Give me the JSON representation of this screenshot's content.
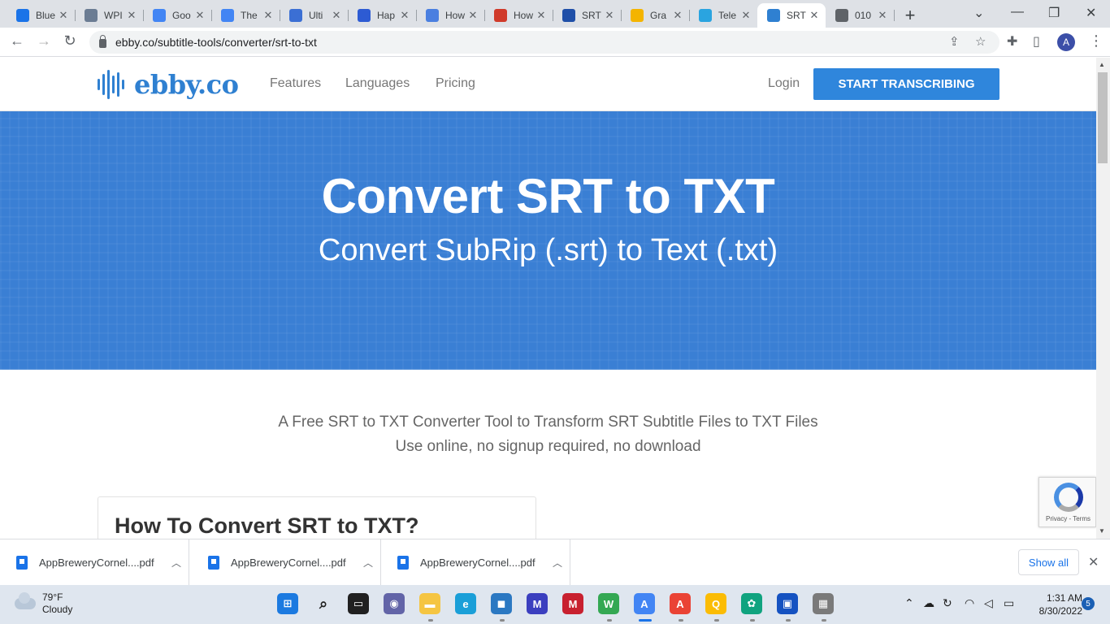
{
  "browser": {
    "tabs": [
      {
        "title": "Blue",
        "fav_color": "#1a73e8",
        "active": false
      },
      {
        "title": "WPI",
        "fav_color": "#6b7c93",
        "active": false
      },
      {
        "title": "Goo",
        "fav_color": "#4285f4",
        "active": false
      },
      {
        "title": "The",
        "fav_color": "#4285f4",
        "active": false
      },
      {
        "title": "Ulti",
        "fav_color": "#3b6fd4",
        "active": false
      },
      {
        "title": "Hap",
        "fav_color": "#2d5bd3",
        "active": false
      },
      {
        "title": "How",
        "fav_color": "#4a7fe0",
        "active": false
      },
      {
        "title": "How",
        "fav_color": "#d03a2a",
        "active": false
      },
      {
        "title": "SRT",
        "fav_color": "#1f4fa8",
        "active": false
      },
      {
        "title": "Gra",
        "fav_color": "#f4b400",
        "active": false
      },
      {
        "title": "Tele",
        "fav_color": "#2aa4e0",
        "active": false
      },
      {
        "title": "SRT",
        "fav_color": "#2f80d1",
        "active": true
      },
      {
        "title": "010",
        "fav_color": "#5f6368",
        "active": false
      }
    ],
    "url": "ebby.co/subtitle-tools/converter/srt-to-txt",
    "avatar_letter": "A"
  },
  "site": {
    "logo_text": "ebby.co",
    "nav": [
      "Features",
      "Languages",
      "Pricing"
    ],
    "login": "Login",
    "cta": "START TRANSCRIBING",
    "brand_color": "#2f80d1"
  },
  "hero": {
    "title": "Convert SRT to TXT",
    "subtitle": "Convert SubRip (.srt) to Text (.txt)",
    "bg_color": "#3a7fd4"
  },
  "intro": {
    "line1": "A Free SRT to TXT Converter Tool to Transform SRT Subtitle Files to TXT Files",
    "line2": "Use online, no signup required, no download"
  },
  "howto": {
    "heading": "How To Convert SRT to TXT?"
  },
  "recaptcha": {
    "text": "Privacy - Terms"
  },
  "downloads": {
    "items": [
      "AppBreweryCornel....pdf",
      "AppBreweryCornel....pdf",
      "AppBreweryCornel....pdf"
    ],
    "show_all": "Show all"
  },
  "taskbar": {
    "weather_temp": "79°F",
    "weather_desc": "Cloudy",
    "time": "1:31 AM",
    "date": "8/30/2022",
    "notifications": "5",
    "badges": {
      "w": "W",
      "a": "A",
      "q": "Q"
    }
  }
}
